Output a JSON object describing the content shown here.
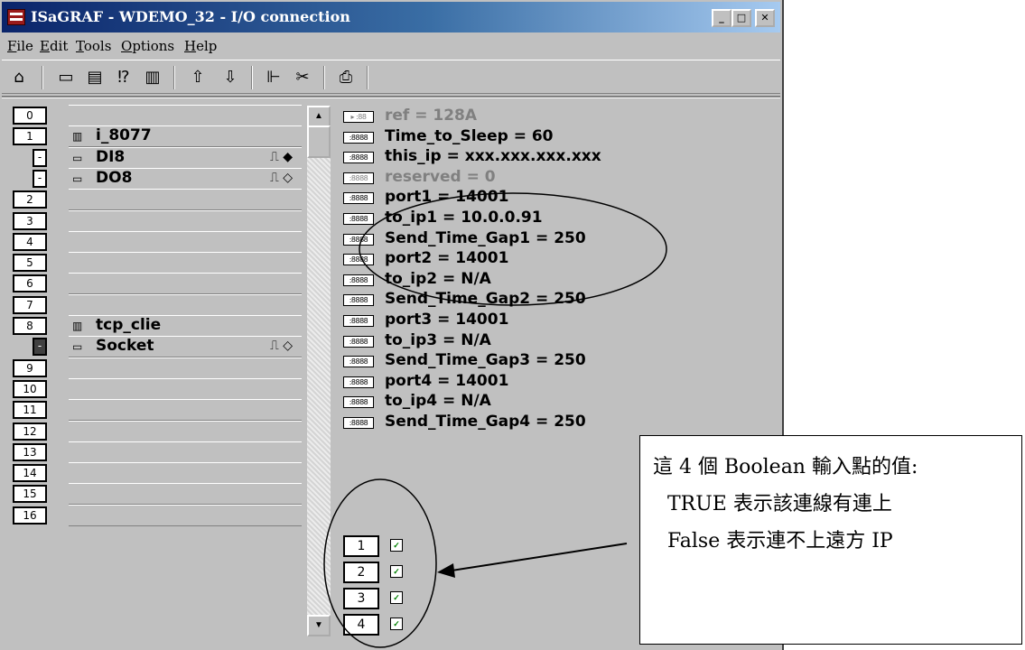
{
  "window": {
    "title": "ISaGRAF - WDEMO_32 - I/O connection",
    "controls": {
      "minimize": "_",
      "maximize": "□",
      "close": "✕"
    }
  },
  "menu": [
    "File",
    "Edit",
    "Tools",
    "Options",
    "Help"
  ],
  "toolbar_icons": [
    "open-icon",
    "board-icon",
    "board-list-icon",
    "help-cursor-icon",
    "trash-icon",
    "arrow-up-icon",
    "arrow-down-icon",
    "connect-icon",
    "cut-icon",
    "print-icon"
  ],
  "slots": [
    {
      "num": "0",
      "label": "",
      "icon": ""
    },
    {
      "num": "1",
      "label": "i_8077",
      "icon": "board-icon"
    },
    {
      "num": "-",
      "label": "DI8",
      "icon": "channel-icon",
      "child": true,
      "ch": "⎍ ◆"
    },
    {
      "num": "-",
      "label": "DO8",
      "icon": "channel-icon",
      "child": true,
      "ch": "⎍ ◇"
    },
    {
      "num": "2",
      "label": "",
      "icon": ""
    },
    {
      "num": "3",
      "label": "",
      "icon": ""
    },
    {
      "num": "4",
      "label": "",
      "icon": ""
    },
    {
      "num": "5",
      "label": "",
      "icon": ""
    },
    {
      "num": "6",
      "label": "",
      "icon": ""
    },
    {
      "num": "7",
      "label": "",
      "icon": ""
    },
    {
      "num": "8",
      "label": "tcp_clie",
      "icon": "board-icon"
    },
    {
      "num": "-",
      "label": "Socket",
      "icon": "channel-icon",
      "child": true,
      "active": true,
      "ch": "⎍ ◇"
    },
    {
      "num": "9",
      "label": "",
      "icon": ""
    },
    {
      "num": "10",
      "label": "",
      "icon": ""
    },
    {
      "num": "11",
      "label": "",
      "icon": ""
    },
    {
      "num": "12",
      "label": "",
      "icon": ""
    },
    {
      "num": "13",
      "label": "",
      "icon": ""
    },
    {
      "num": "14",
      "label": "",
      "icon": ""
    },
    {
      "num": "15",
      "label": "",
      "icon": ""
    },
    {
      "num": "16",
      "label": "",
      "icon": ""
    }
  ],
  "params": [
    {
      "text": "ref = 128A",
      "grey": true,
      "icon": "▸ :88"
    },
    {
      "text": "Time_to_Sleep = 60",
      "icon": ":8888"
    },
    {
      "text": "this_ip = xxx.xxx.xxx.xxx",
      "icon": ":8888"
    },
    {
      "text": "reserved = 0",
      "grey": true,
      "icon": ":8888"
    },
    {
      "text": "port1 = 14001",
      "icon": ":8888"
    },
    {
      "text": "to_ip1 = 10.0.0.91",
      "icon": ":8888"
    },
    {
      "text": "Send_Time_Gap1 = 250",
      "icon": ":8888"
    },
    {
      "text": "port2 = 14001",
      "icon": ":8888"
    },
    {
      "text": "to_ip2 = N/A",
      "icon": ":8888"
    },
    {
      "text": "Send_Time_Gap2 = 250",
      "icon": ":8888"
    },
    {
      "text": "port3 = 14001",
      "icon": ":8888"
    },
    {
      "text": "to_ip3 = N/A",
      "icon": ":8888"
    },
    {
      "text": "Send_Time_Gap3 = 250",
      "icon": ":8888"
    },
    {
      "text": "port4 = 14001",
      "icon": ":8888"
    },
    {
      "text": "to_ip4 = N/A",
      "icon": ":8888"
    },
    {
      "text": "Send_Time_Gap4 = 250",
      "icon": ":8888"
    }
  ],
  "bool_channels": [
    "1",
    "2",
    "3",
    "4"
  ],
  "note": {
    "lines": [
      "這 4 個 Boolean 輸入點的值:",
      "TRUE 表示該連線有連上",
      "False 表示連不上遠方 IP"
    ]
  }
}
